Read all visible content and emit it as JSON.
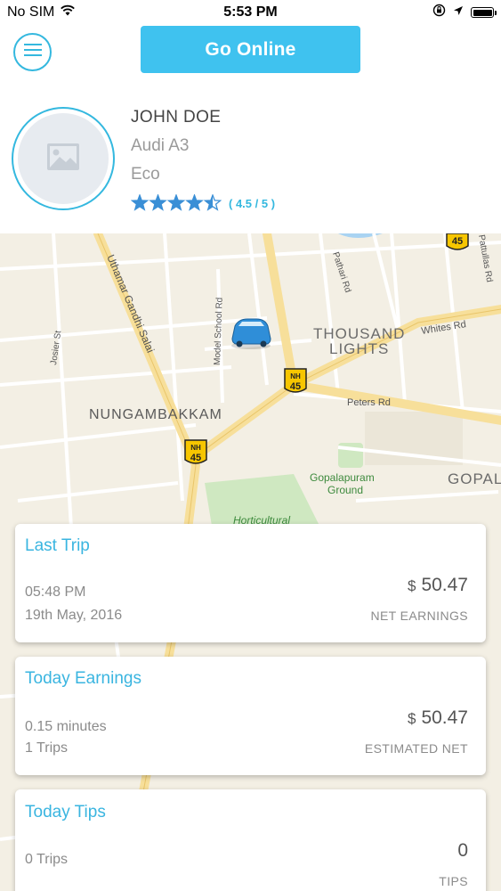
{
  "status_bar": {
    "carrier": "No SIM",
    "time": "5:53 PM"
  },
  "header": {
    "online_button": "Go Online"
  },
  "driver": {
    "name": "JOHN DOE",
    "car_model": "Audi A3",
    "car_class": "Eco",
    "rating_value": 4.5,
    "rating_max": 5,
    "rating_text": "( 4.5 / 5 )"
  },
  "map": {
    "labels": {
      "thousand": "THOUSAND",
      "lights": "LIGHTS",
      "nungambakkam": "NUNGAMBAKKAM",
      "gopalapuram_1": "Gopalapuram",
      "gopalapuram_2": "Ground",
      "gopal": "GOPAL",
      "horticultural": "Horticultural",
      "uthamar": "Uthamar Gandhi Salai",
      "model_school": "Model School Rd",
      "pathari": "Pathari Rd",
      "pattullas": "Pattullas Rd",
      "whites": "Whites Rd",
      "peters": "Peters Rd",
      "josier": "Josier St",
      "nh": "NH",
      "nh_num": "45"
    }
  },
  "cards": {
    "last_trip": {
      "title": "Last Trip",
      "time": "05:48 PM",
      "date": "19th May, 2016",
      "currency": "$",
      "amount": "50.47",
      "label": "NET EARNINGS"
    },
    "today_earnings": {
      "title": "Today Earnings",
      "duration": "0.15 minutes",
      "trips": "1 Trips",
      "currency": "$",
      "amount": "50.47",
      "label": "ESTIMATED NET"
    },
    "today_tips": {
      "title": "Today Tips",
      "trips": "0 Trips",
      "amount": "0",
      "label": "TIPS"
    }
  },
  "colors": {
    "accent": "#3fc2ef",
    "accent_dark": "#34b8df",
    "star": "#3a8fd6"
  }
}
